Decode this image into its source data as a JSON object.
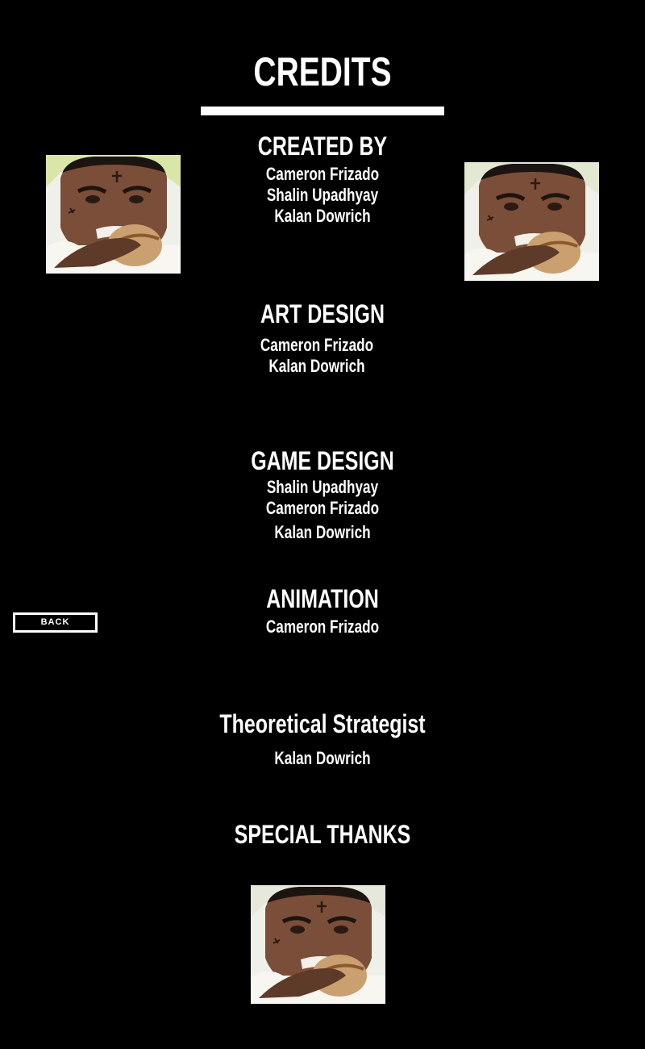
{
  "page": {
    "title": "CREDITS",
    "back_label": "BACK"
  },
  "sections": [
    {
      "heading": "CREATED BY",
      "names": [
        "Cameron Frizado",
        "Shalin Upadhyay",
        "Kalan Dowrich"
      ]
    },
    {
      "heading": "ART DESIGN",
      "names": [
        "Cameron Frizado",
        "Kalan Dowrich"
      ]
    },
    {
      "heading": "GAME DESIGN",
      "names": [
        "Shalin Upadhyay",
        "Cameron Frizado",
        "Kalan Dowrich"
      ]
    },
    {
      "heading": "ANIMATION",
      "names": [
        "Cameron Frizado"
      ]
    },
    {
      "heading": "Theoretical Strategist",
      "names": [
        "Kalan Dowrich"
      ]
    },
    {
      "heading": "SPECIAL THANKS",
      "names": []
    }
  ],
  "colors": {
    "background": "#000000",
    "text": "#ffffff",
    "divider": "#ffffff"
  }
}
